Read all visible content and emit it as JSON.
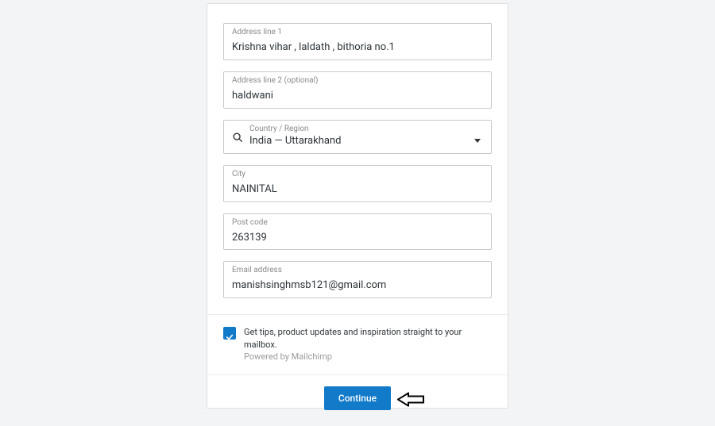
{
  "fields": {
    "address1": {
      "label": "Address line 1",
      "value": "Krishna vihar , laldath , bithoria no.1"
    },
    "address2": {
      "label": "Address line 2 (optional)",
      "value": "haldwani"
    },
    "country": {
      "label": "Country / Region",
      "value": "India — Uttarakhand"
    },
    "city": {
      "label": "City",
      "value": "NAINITAL"
    },
    "postcode": {
      "label": "Post code",
      "value": "263139"
    },
    "email": {
      "label": "Email address",
      "value": "manishsinghmsb121@gmail.com"
    }
  },
  "tips": {
    "main": "Get tips, product updates and inspiration straight to your mailbox.",
    "sub": "Powered by Mailchimp",
    "checked": true
  },
  "buttons": {
    "continue": "Continue"
  },
  "colors": {
    "primary": "#117ac9"
  }
}
